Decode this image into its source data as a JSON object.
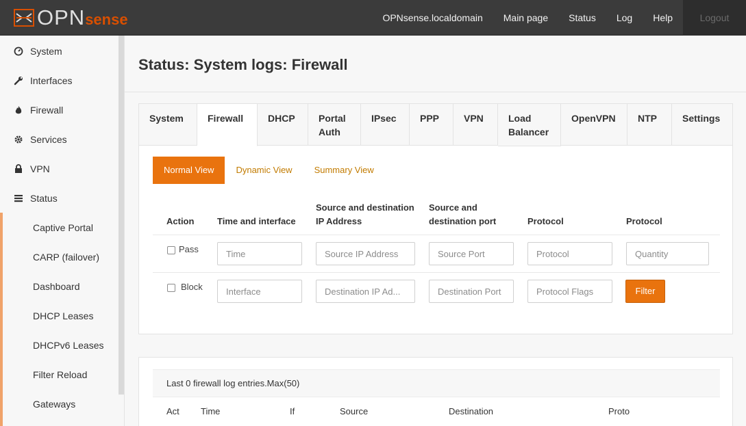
{
  "brand": {
    "part1": "OPN",
    "part2": "sense"
  },
  "nav": {
    "hostname": "OPNsense.localdomain",
    "main_page": "Main page",
    "status": "Status",
    "log": "Log",
    "help": "Help",
    "logout": "Logout"
  },
  "sidebar": {
    "items": [
      {
        "label": "System",
        "icon": "dashboard-icon"
      },
      {
        "label": "Interfaces",
        "icon": "wrench-icon"
      },
      {
        "label": "Firewall",
        "icon": "fire-icon"
      },
      {
        "label": "Services",
        "icon": "gear-icon"
      },
      {
        "label": "VPN",
        "icon": "lock-icon"
      },
      {
        "label": "Status",
        "icon": "list-icon"
      }
    ],
    "subitems": [
      "Captive Portal",
      "CARP (failover)",
      "Dashboard",
      "DHCP Leases",
      "DHCPv6 Leases",
      "Filter Reload",
      "Gateways"
    ]
  },
  "page_title": "Status: System logs: Firewall",
  "tabs": [
    "System",
    "Firewall",
    "DHCP",
    "Portal Auth",
    "IPsec",
    "PPP",
    "VPN",
    "Load Balancer",
    "OpenVPN",
    "NTP",
    "Settings"
  ],
  "tab_lines": {
    "portal_1": "Portal",
    "portal_2": "Auth",
    "lb_1": "Load",
    "lb_2": "Balancer"
  },
  "active_tab": "Firewall",
  "views": {
    "normal": "Normal View",
    "dynamic": "Dynamic View",
    "summary": "Summary View"
  },
  "filter": {
    "headers": {
      "action": "Action",
      "time_iface": "Time and interface",
      "ip_1": "Source and destination",
      "ip_2": "IP Address",
      "port_1": "Source and",
      "port_2": "destination port",
      "protocol": "Protocol",
      "protocol2": "Protocol"
    },
    "pass_label": "Pass",
    "block_label": "Block",
    "placeholders": {
      "time": "Time",
      "src_ip": "Source IP Address",
      "src_port": "Source Port",
      "protocol": "Protocol",
      "quantity": "Quantity",
      "interface": "Interface",
      "dst_ip": "Destination IP Ad...",
      "dst_port": "Destination Port",
      "proto_flags": "Protocol Flags"
    },
    "button": "Filter"
  },
  "log": {
    "info": "Last 0 firewall log entries.Max(50)",
    "columns": [
      "Act",
      "Time",
      "If",
      "Source",
      "Destination",
      "Proto"
    ]
  },
  "colors": {
    "accent": "#e9730e",
    "topbar": "#3b3b3b",
    "link": "#c27b00"
  }
}
